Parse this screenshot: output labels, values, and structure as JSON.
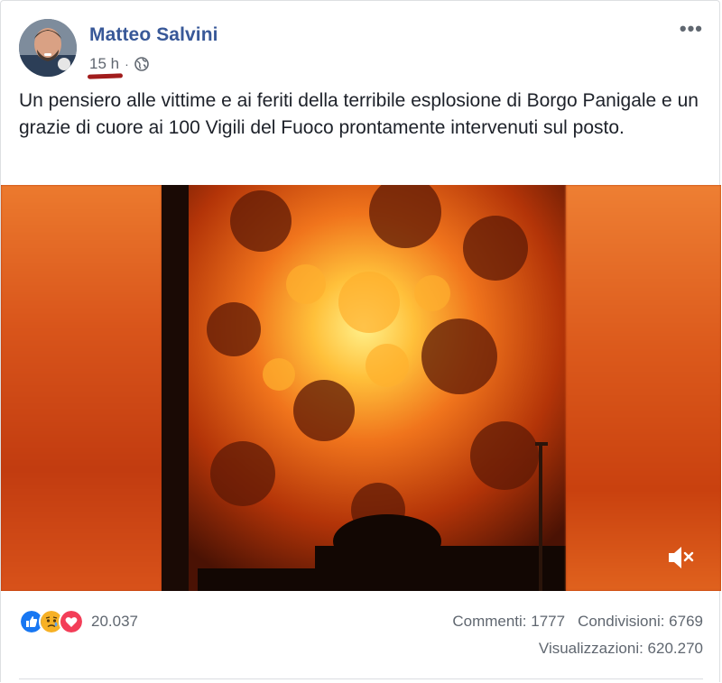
{
  "post": {
    "author": "Matteo Salvini",
    "time": "15 h",
    "separator": "·",
    "privacy_icon": "globe-icon",
    "more_icon": "more-options-icon",
    "text": "Un pensiero alle vittime e ai feriti della terribile esplosione di Borgo Panigale e un grazie di cuore ai 100 Vigili del Fuoco prontamente intervenuti sul posto."
  },
  "video": {
    "mute_icon": "speaker-muted-icon"
  },
  "footer": {
    "reactions": [
      "like-icon",
      "sad-icon",
      "love-icon"
    ],
    "reaction_count": "20.037",
    "comments": "Commenti: 1777",
    "shares": "Condivisioni: 6769",
    "views": "Visualizzazioni: 620.270"
  },
  "colors": {
    "author": "#385898",
    "secondary_text": "#606770",
    "like": "#1877f2",
    "love": "#f33e58",
    "sad": "#f7b125"
  }
}
